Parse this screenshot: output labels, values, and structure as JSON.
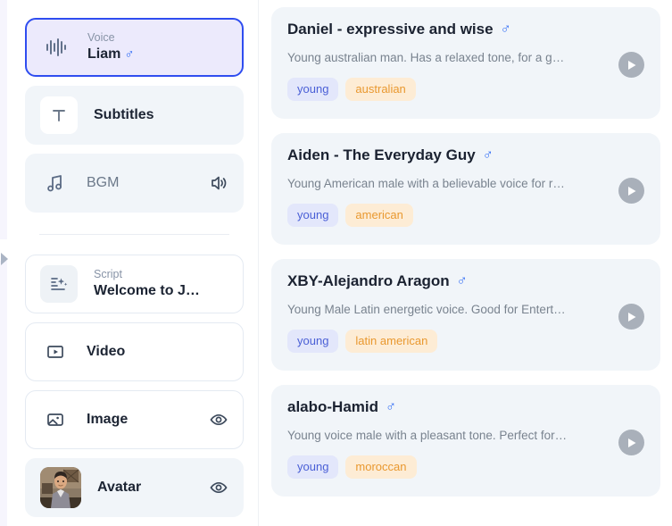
{
  "sidebar": {
    "items": [
      {
        "key": "voice",
        "sublabel": "Voice",
        "label": "Liam",
        "gender": "♂",
        "icon": "waveform-icon",
        "state": "active",
        "right_icon": ""
      },
      {
        "key": "subtitles",
        "sublabel": "",
        "label": "Subtitles",
        "gender": "",
        "icon": "text-t-icon",
        "state": "filled",
        "right_icon": ""
      },
      {
        "key": "bgm",
        "sublabel": "",
        "label": "BGM",
        "gender": "",
        "icon": "music-note-icon",
        "state": "filled",
        "right_icon": "speaker-icon"
      },
      {
        "key": "script",
        "sublabel": "Script",
        "label": "Welcome to J…",
        "gender": "",
        "icon": "ai-script-icon",
        "state": "outlined",
        "right_icon": ""
      },
      {
        "key": "video",
        "sublabel": "",
        "label": "Video",
        "gender": "",
        "icon": "video-play-icon",
        "state": "outlined",
        "right_icon": ""
      },
      {
        "key": "image",
        "sublabel": "",
        "label": "Image",
        "gender": "",
        "icon": "image-icon",
        "state": "outlined",
        "right_icon": "eye-icon"
      },
      {
        "key": "avatar",
        "sublabel": "",
        "label": "Avatar",
        "gender": "",
        "icon": "avatar-thumbnail",
        "state": "filled",
        "right_icon": "eye-icon"
      }
    ]
  },
  "collapse_handle": {
    "icon": "chevron-right-icon"
  },
  "voices": [
    {
      "name": "Daniel - expressive and wise",
      "gender": "♂",
      "description": "Young australian man. Has a relaxed tone, for a g…",
      "tags": [
        "young",
        "australian"
      ],
      "play": "play-icon"
    },
    {
      "name": "Aiden - The Everyday Guy",
      "gender": "♂",
      "description": "Young American male with a believable voice for r…",
      "tags": [
        "young",
        "american"
      ],
      "play": "play-icon"
    },
    {
      "name": "XBY-Alejandro Aragon",
      "gender": "♂",
      "description": "Young Male Latin energetic voice. Good for Entert…",
      "tags": [
        "young",
        "latin american"
      ],
      "play": "play-icon"
    },
    {
      "name": "alabo-Hamid",
      "gender": "♂",
      "description": "Young voice male with a pleasant tone. Perfect for…",
      "tags": [
        "young",
        "moroccan"
      ],
      "play": "play-icon"
    }
  ],
  "colors": {
    "accent": "#2f4df0",
    "active_bg": "#eceafc",
    "card_bg": "#f1f5f9",
    "tag_blue_bg": "#e3e7fb",
    "tag_blue_fg": "#4a5fd6",
    "tag_orange_bg": "#fdecd5",
    "tag_orange_fg": "#e9982f",
    "rail": "#f6f5fd"
  }
}
